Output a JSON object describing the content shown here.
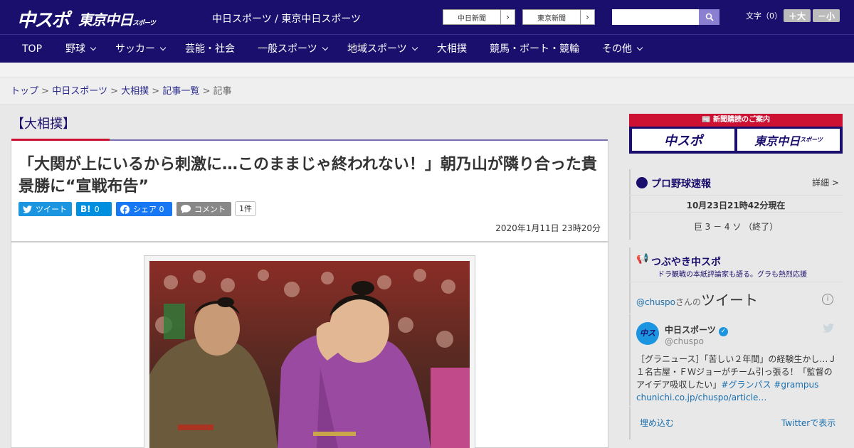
{
  "header": {
    "logo_main": "中スポ",
    "logo_sub": "東京中日",
    "logo_sub_small": "スポーツ",
    "site_name": "中日スポーツ / 東京中日スポーツ",
    "ext_links": [
      "中日新聞",
      "東京新聞"
    ],
    "search_placeholder": "",
    "font_label": "文字（0）",
    "font_bigger": "＋大",
    "font_smaller": "－小"
  },
  "nav": {
    "items": [
      {
        "label": "TOP"
      },
      {
        "label": "野球"
      },
      {
        "label": "サッカー"
      },
      {
        "label": "芸能・社会"
      },
      {
        "label": "一般スポーツ"
      },
      {
        "label": "地域スポーツ"
      },
      {
        "label": "大相撲"
      },
      {
        "label": "競馬・ボート・競輪"
      },
      {
        "label": "その他"
      }
    ]
  },
  "breadcrumb": {
    "items": [
      "トップ",
      "中日スポーツ",
      "大相撲",
      "記事一覧"
    ],
    "current": "記事",
    "sep": ">"
  },
  "article": {
    "category": "【大相撲】",
    "title": "「大関が上にいるから刺激に…このままじゃ終われない！」朝乃山が隣り合った貴景勝に“宣戦布告”",
    "date": "2020年1月11日 23時20分",
    "share": {
      "tweet": "ツイート",
      "hatena_icon": "B!",
      "hatena_count": "0",
      "facebook": "シェア 0",
      "comment": "コメント",
      "comment_count": "1件"
    }
  },
  "sidebar": {
    "ad_header": "新聞購読のご案内",
    "ad_left": "中スポ",
    "ad_right": "東京中日",
    "ad_right_small": "スポーツ",
    "baseball": {
      "title": "プロ野球速報",
      "more": "詳細 >",
      "timestamp": "10月23日21時42分現在",
      "score": "巨 3 － 4 ソ （終了）"
    },
    "tweets": {
      "title": "つぶやき中スポ",
      "subtitle": "ドラ観戦の本紙評論家も語る。グラも熱烈応援",
      "handle": "@chuspo",
      "handle_suffix": "さんの",
      "tweet_word": "ツイート",
      "user_name": "中日スポーツ",
      "user_handle": "@chuspo",
      "tweet_text": "［グラニュース］「苦しい２年間」の経験生かし…Ｊ１名古屋・ＦＷジョーがチーム引っ張る！「監督のアイデア吸収したい」",
      "hashtags": "#グランパス #grampus",
      "link": "chunichi.co.jp/chuspo/article…",
      "embed": "埋め込む",
      "view_on_twitter": "Twitterで表示"
    }
  },
  "colors": {
    "navy": "#1b0f6e",
    "red": "#cc1133",
    "twitter": "#1b95e0",
    "hatena": "#008fde",
    "facebook": "#1877f2"
  }
}
